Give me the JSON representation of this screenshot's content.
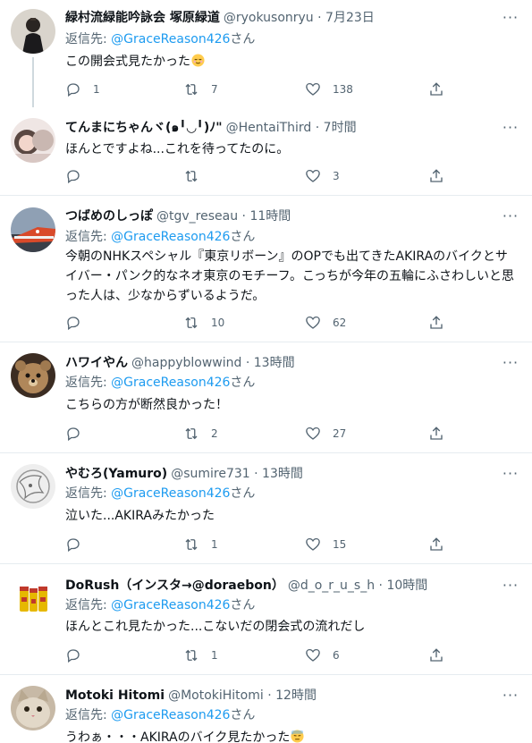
{
  "colors": {
    "accent": "#1d9bf0",
    "text": "#0f1419",
    "secondary": "#536471",
    "divider": "#e6ecf0"
  },
  "tweets": [
    {
      "name": "緑村流緑能吟詠会 塚原緑道",
      "handle": "@ryokusonryu",
      "dot": "·",
      "time": "7月23日",
      "reply_prefix": "返信先: ",
      "reply_mention": "@GraceReason426",
      "reply_suffix": "さん",
      "text": "この開会式見たかった",
      "emoji": "relieved-face-emoji",
      "reply_count": "1",
      "retweet_count": "7",
      "like_count": "138"
    },
    {
      "name": "てんまにちゃんヾ(๑╹◡╹)ﾉ\"",
      "handle": "@HentaiThird",
      "dot": "·",
      "time": "7时間",
      "text": "ほんとですよね...これを待ってたのに。",
      "reply_count": "",
      "retweet_count": "",
      "like_count": "3"
    },
    {
      "name": "つばめのしっぽ",
      "handle": "@tgv_reseau",
      "dot": "·",
      "time": "11時間",
      "reply_prefix": "返信先: ",
      "reply_mention": "@GraceReason426",
      "reply_suffix": "さん",
      "text": "今朝のNHKスペシャル『東京リボーン』のOPでも出てきたAKIRAのバイクとサイバー・パンク的なネオ東京のモチーフ。こっちが今年の五輪にふさわしいと思った人は、少なからずいるようだ。",
      "reply_count": "",
      "retweet_count": "10",
      "like_count": "62"
    },
    {
      "name": "ハワイやん",
      "handle": "@happyblowwind",
      "dot": "·",
      "time": "13時間",
      "reply_prefix": "返信先: ",
      "reply_mention": "@GraceReason426",
      "reply_suffix": "さん",
      "text": "こちらの方が断然良かった！",
      "reply_count": "",
      "retweet_count": "2",
      "like_count": "27"
    },
    {
      "name": "やむろ(Yamuro)",
      "handle": "@sumire731",
      "dot": "·",
      "time": "13時間",
      "reply_prefix": "返信先: ",
      "reply_mention": "@GraceReason426",
      "reply_suffix": "さん",
      "text": "泣いた...AKIRAみたかった",
      "reply_count": "",
      "retweet_count": "1",
      "like_count": "15"
    },
    {
      "name": "DoRush（インスタ→@doraebon）",
      "handle": "@d_o_r_u_s_h",
      "dot": "·",
      "time": "10時間",
      "reply_prefix": "返信先: ",
      "reply_mention": "@GraceReason426",
      "reply_suffix": "さん",
      "text": "ほんとこれ見たかった...こないだの閉会式の流れだし",
      "reply_count": "",
      "retweet_count": "1",
      "like_count": "6"
    },
    {
      "name": "Motoki Hitomi",
      "handle": "@MotokiHitomi",
      "dot": "·",
      "time": "12時間",
      "reply_prefix": "返信先: ",
      "reply_mention": "@GraceReason426",
      "reply_suffix": "さん",
      "text": "うわぁ・・・AKIRAのバイク見たかった",
      "emoji": "downcast-sweat-face-emoji"
    }
  ]
}
